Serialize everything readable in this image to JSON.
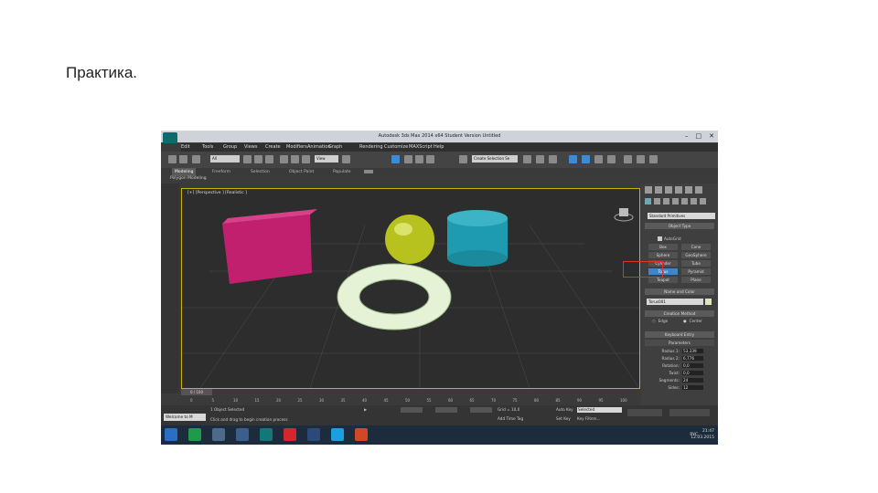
{
  "slide": {
    "title": "Практика."
  },
  "window": {
    "title": "Autodesk 3ds Max 2014 x64    Student Version    Untitled",
    "controls": [
      "–",
      "□",
      "✕"
    ]
  },
  "menu": [
    "Edit",
    "Tools",
    "Group",
    "Views",
    "Create",
    "Modifiers",
    "Animation",
    "Graph Editors",
    "Rendering",
    "Customize",
    "MAXScript",
    "Help"
  ],
  "toolbar": {
    "filter": "All",
    "ref_coord": "View",
    "named_sel": "Create Selection Se"
  },
  "ribbon": {
    "tabs": [
      "Modeling",
      "Freeform",
      "Selection",
      "Object Paint",
      "Populate"
    ],
    "subtitle": "Polygon Modeling"
  },
  "viewport": {
    "label": "[+] [Perspective ] [Realistic ]"
  },
  "command_panel": {
    "category": "Standard Primitives",
    "object_type_header": "Object Type",
    "autogrid": "AutoGrid",
    "buttons": [
      "Box",
      "Cone",
      "Sphere",
      "GeoSphere",
      "Cylinder",
      "Tube",
      "Torus",
      "Pyramid",
      "Teapot",
      "Plane"
    ],
    "selected": "Torus",
    "name_color_header": "Name and Color",
    "name_value": "Torus001",
    "creation_header": "Creation Method",
    "creation_options": [
      "Edge",
      "Center"
    ],
    "keyboard_header": "Keyboard Entry",
    "params_header": "Parameters",
    "params": [
      {
        "label": "Radius 1:",
        "value": "53,339"
      },
      {
        "label": "Radius 2:",
        "value": "6,776"
      },
      {
        "label": "Rotation:",
        "value": "0,0"
      },
      {
        "label": "Twist:",
        "value": "0,0"
      },
      {
        "label": "Segments:",
        "value": "24"
      },
      {
        "label": "Sides:",
        "value": "12"
      }
    ]
  },
  "timeline": {
    "slider": "0 / 100",
    "ticks": [
      "0",
      "5",
      "10",
      "15",
      "20",
      "25",
      "30",
      "35",
      "40",
      "45",
      "50",
      "55",
      "60",
      "65",
      "70",
      "75",
      "80",
      "85",
      "90",
      "95",
      "100"
    ]
  },
  "status": {
    "welcome": "Welcome to M",
    "prompt": "1 Object Selected",
    "hint": "Click and drag to begin creation process",
    "grid": "Grid = 10,0",
    "add_time_tag": "Add Time Tag",
    "auto_key": "Auto Key",
    "selected": "Selected",
    "set_key": "Set Key",
    "key_filters": "Key Filters..."
  },
  "taskbar": {
    "apps": [
      "windows-icon",
      "explorer-icon",
      "store-icon",
      "vk-icon",
      "3dsmax-icon",
      "yandex-icon",
      "steam-icon",
      "skype-icon",
      "powerpoint-icon"
    ],
    "lang": "РУС",
    "time": "21:47",
    "date": "12.03.2015"
  },
  "colors": {
    "box": "#c0206e",
    "sphere": "#b8c21e",
    "cylinder": "#1e9bb0",
    "torus": "#e6f2d6",
    "accent": "#3d86c9"
  }
}
